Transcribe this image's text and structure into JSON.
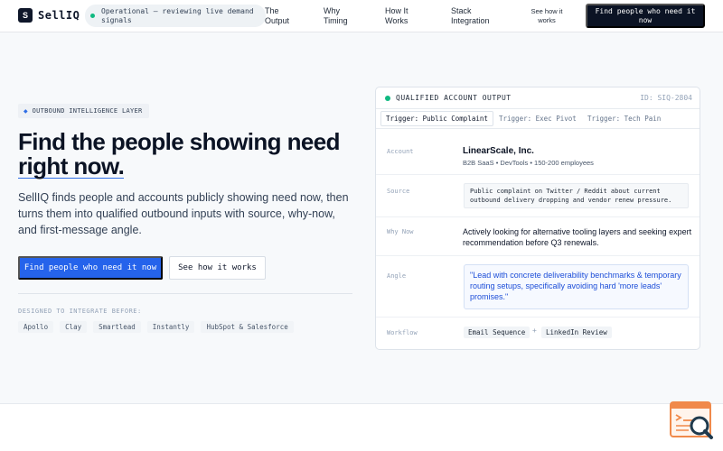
{
  "header": {
    "logo_letter": "S",
    "brand": "SellIQ",
    "status": "Operational — reviewing live demand signals",
    "nav": [
      "The Output",
      "Why Timing",
      "How It Works",
      "Stack Integration",
      "See how it works"
    ],
    "cta": "Find people who need it now"
  },
  "hero": {
    "eyebrow": "OUTBOUND INTELLIGENCE LAYER",
    "headline_line1": "Find the people showing need",
    "headline_line2": "right now.",
    "lead": "SellIQ finds people and accounts publicly showing need now, then turns them into qualified outbound inputs with source, why-now, and first-message angle.",
    "primary_button": "Find people who need it now",
    "secondary_button": "See how it works",
    "integrate_label": "DESIGNED TO INTEGRATE BEFORE:",
    "integrations": [
      "Apollo",
      "Clay",
      "Smartlead",
      "Instantly",
      "HubSpot & Salesforce"
    ]
  },
  "card": {
    "title": "QUALIFIED ACCOUNT OUTPUT",
    "id": "ID: SIQ-2804",
    "tabs": [
      "Trigger: Public Complaint",
      "Trigger: Exec Pivot",
      "Trigger: Tech Pain"
    ],
    "active_tab": 0,
    "labels": {
      "account": "Account",
      "source": "Source",
      "why_now": "Why Now",
      "angle": "Angle",
      "workflow": "Workflow"
    },
    "account_name": "LinearScale, Inc.",
    "account_meta": "B2B SaaS • DevTools • 150-200 employees",
    "source": "Public complaint on Twitter / Reddit about current outbound delivery dropping and vendor renew pressure.",
    "why_now": "Actively looking for alternative tooling layers and seeking expert recommendation before Q3 renewals.",
    "angle": "\"Lead with concrete deliverability benchmarks & temporary routing setups, specifically avoiding hard 'more leads' promises.\"",
    "workflow": [
      "Email Sequence",
      "+",
      "LinkedIn Review"
    ]
  },
  "colors": {
    "accent": "#2563eb",
    "status": "#10b981",
    "dark": "#0b1324"
  },
  "icons": {
    "eyebrow": "diamond-icon",
    "widget": "search-document-icon"
  }
}
